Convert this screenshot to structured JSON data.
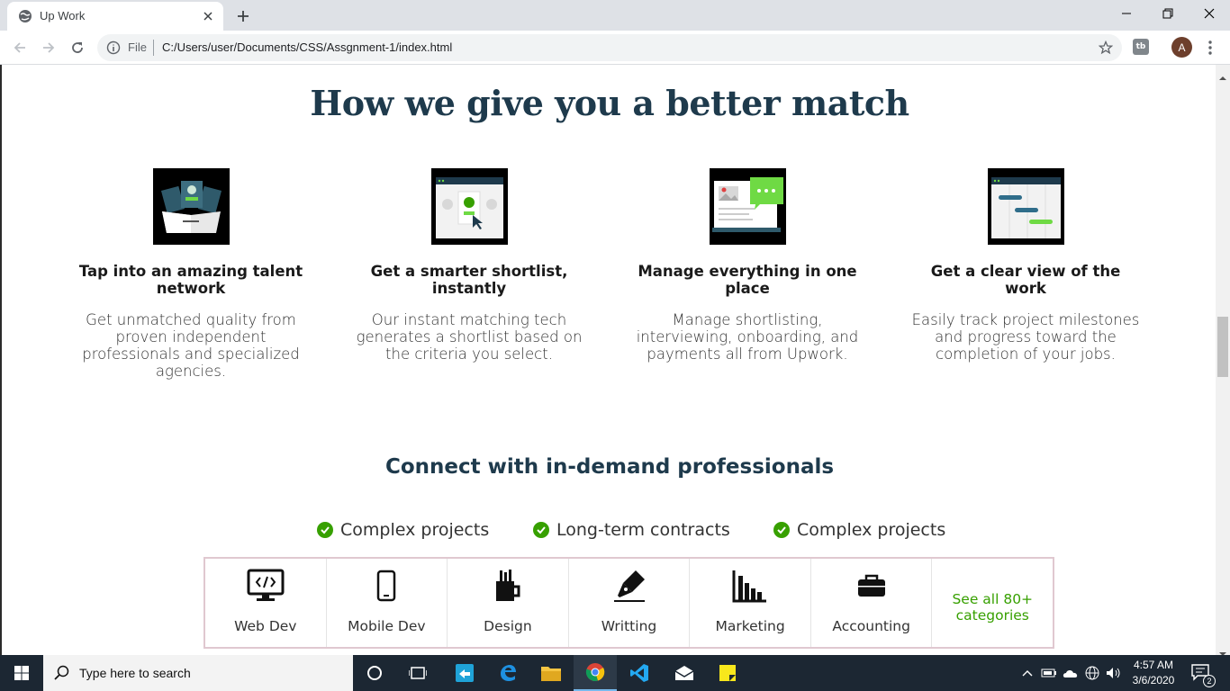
{
  "browser": {
    "tab_title": "Up Work",
    "scheme_label": "File",
    "url": "C:/Users/user/Documents/CSS/Assgnment-1/index.html",
    "avatar_letter": "A"
  },
  "page": {
    "heading": "How we give you a better match",
    "features": [
      {
        "title": "Tap into an amazing talent network",
        "desc": "Get unmatched quality from proven independent professionals and specialized agencies.",
        "icon": "talent-network-icon"
      },
      {
        "title": "Get a smarter shortlist, instantly",
        "desc": "Our instant matching tech generates a shortlist based on the criteria you select.",
        "icon": "shortlist-icon"
      },
      {
        "title": "Manage everything in one place",
        "desc": "Manage shortlisting, interviewing, onboarding, and payments all from Upwork.",
        "icon": "manage-icon"
      },
      {
        "title": "Get a clear view of the work",
        "desc": "Easily track project milestones and progress toward the completion of your jobs.",
        "icon": "timeline-icon"
      }
    ],
    "subheading": "Connect with in-demand professionals",
    "checks": [
      "Complex projects",
      "Long-term contracts",
      "Complex projects"
    ],
    "categories": [
      {
        "label": "Web Dev",
        "icon": "monitor-code-icon"
      },
      {
        "label": "Mobile Dev",
        "icon": "mobile-icon"
      },
      {
        "label": "Design",
        "icon": "pencil-cup-icon"
      },
      {
        "label": "Writting",
        "icon": "pen-nib-icon"
      },
      {
        "label": "Marketing",
        "icon": "bar-chart-icon"
      },
      {
        "label": "Accounting",
        "icon": "briefcase-icon"
      }
    ],
    "see_all": "See all 80+ categories"
  },
  "taskbar": {
    "search_placeholder": "Type here to search",
    "time": "4:57 AM",
    "date": "3/6/2020",
    "notification_count": "2"
  },
  "colors": {
    "accent_green": "#37a000",
    "heading_navy": "#1e3a4c",
    "taskbar_bg": "#1c2733"
  }
}
